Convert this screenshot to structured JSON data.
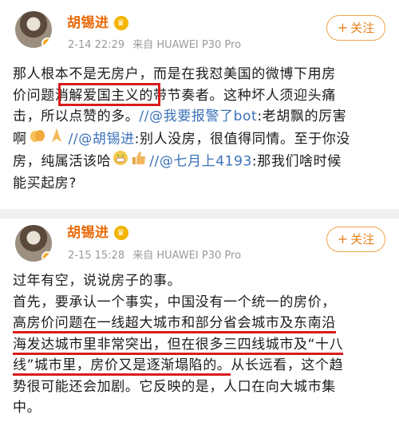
{
  "posts": [
    {
      "author": "胡锡进",
      "time": "2-14 22:29",
      "source": "来自 HUAWEI P30 Pro",
      "follow_label": "关注",
      "text": {
        "l1": "那人根本不是无房户，而是在我怼美国的微博下用房",
        "l2a": "价问题",
        "l2b": "消解爱国主义",
        "l2c": "的带节奏者。这种坏人须迎头痛",
        "l3a": "击，所以点赞的多。",
        "l3b": "//@我要报警了bot",
        "l3c": ":老胡飘的厉害",
        "l4a": "啊",
        "l4b": "//@胡锡进",
        "l4c": ":别人没房，很值得同情。至于你没",
        "l5a": "房，纯属活该哈",
        "l5b": "//@七月上4193",
        "l5c": ":那我们啥时候",
        "l6": "能买起房?"
      }
    },
    {
      "author": "胡锡进",
      "time": "2-15 15:28",
      "source": "来自 HUAWEI P30 Pro",
      "follow_label": "关注",
      "text": {
        "l1": "过年有空，说说房子的事。",
        "l2": "首先，要承认一个事实，中国没有一个统一的房价，",
        "l3": "高房价问题在一线超大城市和部分省会城市及东南沿",
        "l4": "海发达城市里非常突出，但在很多三四线城市及“十八",
        "l5a": "线”城市里，房价又是逐渐塌陷的。",
        "l5b": "从长远看，这个趋",
        "l6": "势很可能还会加剧。它反映的是，人口在向大城市集",
        "l7": "中。"
      }
    }
  ],
  "icons": {
    "vip": "vip-badge-icon",
    "plus": "plus-icon",
    "emoji": [
      "clap-emoji",
      "pray-emoji",
      "grin-emoji",
      "thumbs-up-emoji"
    ]
  },
  "colors": {
    "author": "#ea6a08",
    "link": "#3a72b8",
    "annotation": "#d91c1c",
    "follow": "#e9801a"
  }
}
